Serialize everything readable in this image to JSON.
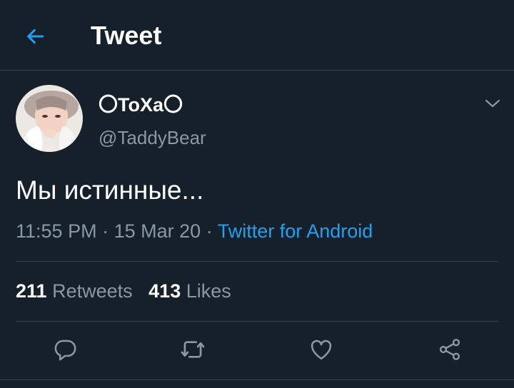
{
  "header": {
    "title": "Tweet",
    "back_icon": "arrow-left-icon"
  },
  "colors": {
    "background": "#15202b",
    "accent": "#1da1f2",
    "secondary_text": "#8899a6",
    "divider": "#38444d"
  },
  "tweet": {
    "display_name": "〇ToXa〇",
    "handle": "@TaddyBear",
    "text": "Мы истинные...",
    "time": "11:55 PM",
    "separator": "·",
    "date": "15 Mar 20",
    "source": "Twitter for Android"
  },
  "stats": {
    "retweets_count": "211",
    "retweets_label": "Retweets",
    "likes_count": "413",
    "likes_label": "Likes"
  },
  "actions": [
    {
      "icon": "reply-icon"
    },
    {
      "icon": "retweet-icon"
    },
    {
      "icon": "heart-icon"
    },
    {
      "icon": "share-icon"
    }
  ]
}
